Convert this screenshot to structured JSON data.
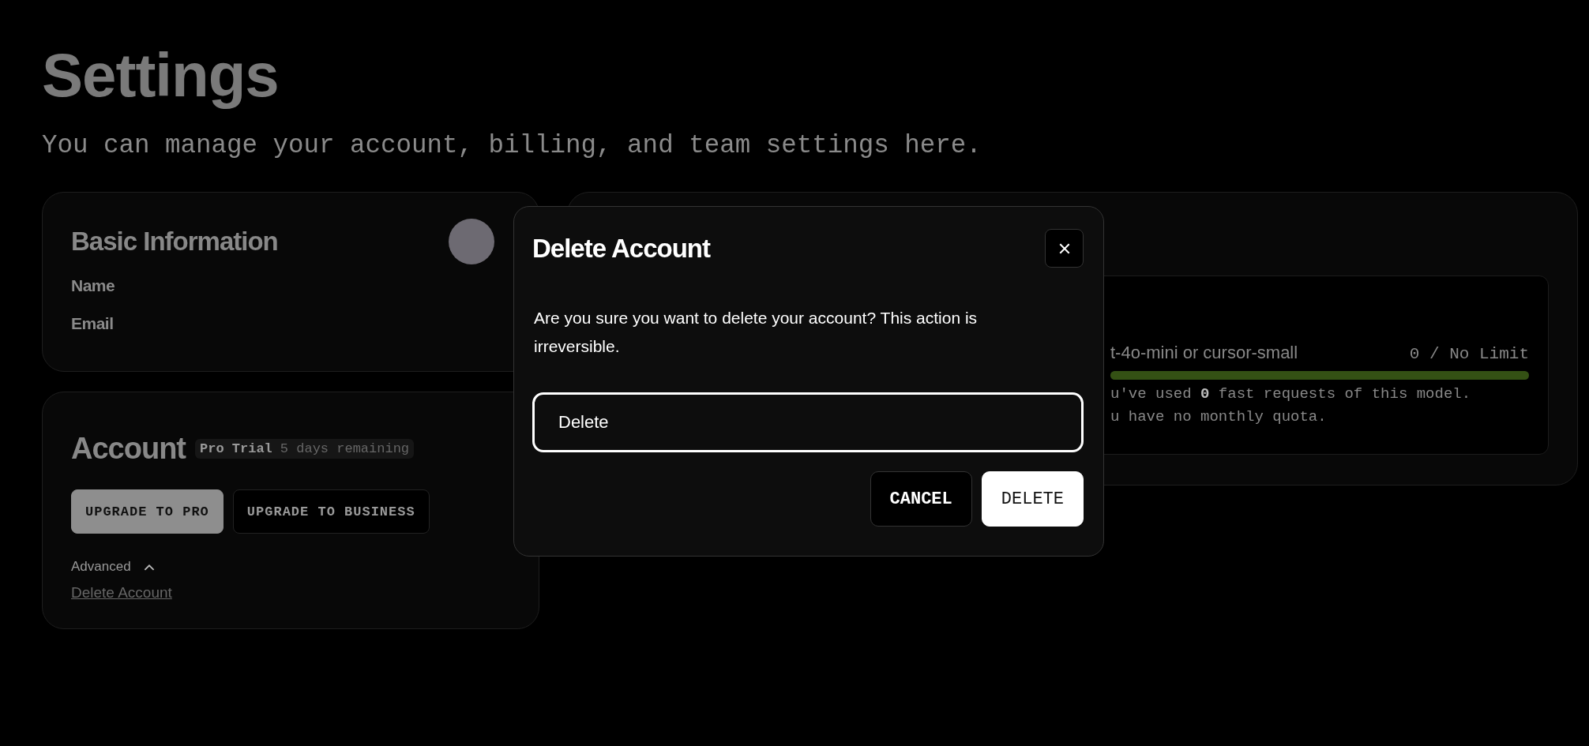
{
  "page": {
    "title": "Settings",
    "subtitle": "You can manage your account, billing, and team settings here."
  },
  "basic_info": {
    "title": "Basic Information",
    "fields": [
      {
        "label": "Name"
      },
      {
        "label": "Email"
      }
    ]
  },
  "account": {
    "title": "Account",
    "plan": "Pro Trial",
    "trial_note": "5 days remaining",
    "buttons": [
      {
        "label": "UPGRADE TO PRO",
        "kind": "primary"
      },
      {
        "label": "UPGRADE TO BUSINESS",
        "kind": "secondary"
      }
    ],
    "advanced": {
      "label": "Advanced",
      "expanded": true
    },
    "delete_link": "Delete Account"
  },
  "usage": {
    "model": "t-4o-mini or cursor-small",
    "count": "0 / No Limit",
    "level": 1,
    "lines": [
      "u've used **0** fast requests of this model.",
      "u have no monthly quota."
    ]
  },
  "dialog": {
    "title": "Delete Account",
    "message": "Are you sure you want to delete your account? This action is irreversible.",
    "input_value": "Delete",
    "buttons": [
      {
        "label": "CANCEL",
        "kind": "secondary"
      },
      {
        "label": "DELETE",
        "kind": "primary"
      }
    ]
  }
}
